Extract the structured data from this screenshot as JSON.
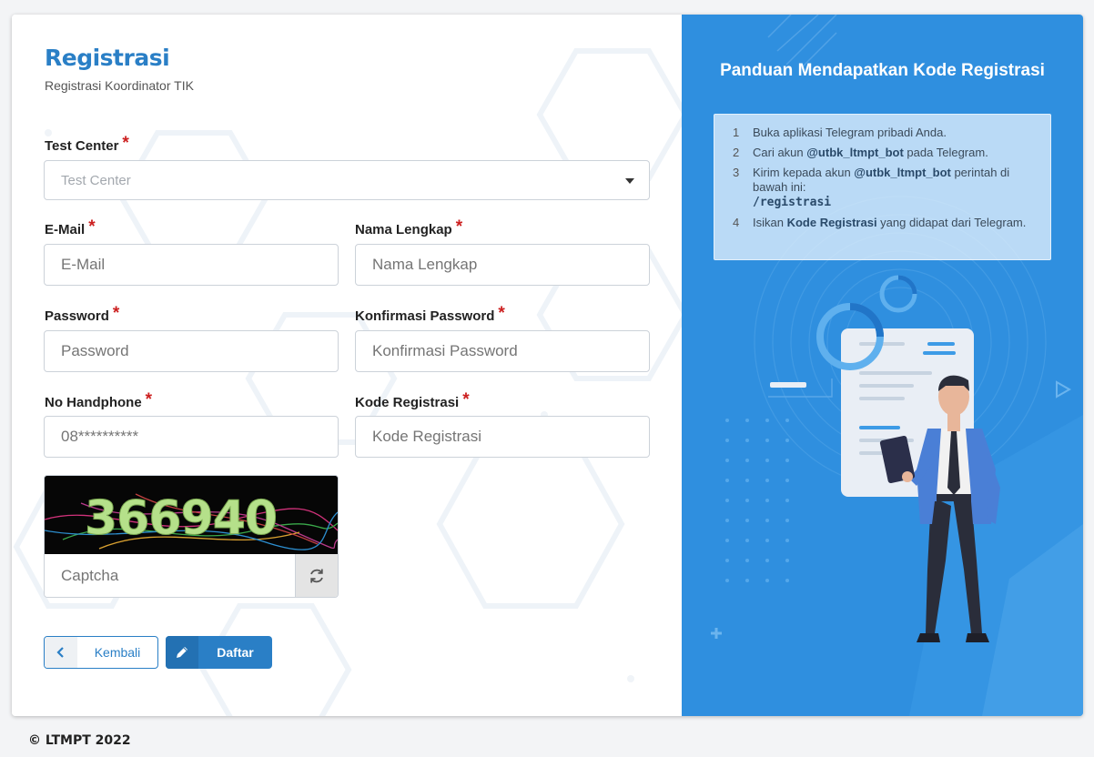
{
  "form": {
    "title": "Registrasi",
    "subtitle": "Registrasi Koordinator TIK",
    "required_mark": "*",
    "test_center": {
      "label": "Test Center",
      "placeholder": "Test Center"
    },
    "email": {
      "label": "E-Mail",
      "placeholder": "E-Mail"
    },
    "full_name": {
      "label": "Nama Lengkap",
      "placeholder": "Nama Lengkap"
    },
    "password": {
      "label": "Password",
      "placeholder": "Password"
    },
    "confirm_password": {
      "label": "Konfirmasi Password",
      "placeholder": "Konfirmasi Password"
    },
    "phone": {
      "label": "No Handphone",
      "placeholder": "08**********"
    },
    "registration_code": {
      "label": "Kode Registrasi",
      "placeholder": "Kode Registrasi"
    },
    "captcha": {
      "image_text": "366940",
      "placeholder": "Captcha"
    },
    "back_button": "Kembali",
    "submit_button": "Daftar"
  },
  "guide": {
    "title": "Panduan Mendapatkan Kode Registrasi",
    "steps": [
      {
        "num": "1",
        "text": "Buka aplikasi Telegram pribadi Anda."
      },
      {
        "num": "2",
        "pre": "Cari akun ",
        "bold": "@utbk_ltmpt_bot",
        "post": " pada Telegram."
      },
      {
        "num": "3",
        "pre": "Kirim kepada akun ",
        "bold": "@utbk_ltmpt_bot",
        "post": " perintah di bawah ini:",
        "command": "/registrasi"
      },
      {
        "num": "4",
        "pre": "Isikan ",
        "bold": "Kode Registrasi",
        "post": " yang didapat dari Telegram."
      }
    ]
  },
  "footer": {
    "copyright": "© LTMPT 2022"
  },
  "colors": {
    "accent": "#2a7fc6",
    "panel": "#2f8fdf",
    "required": "#cc1f1f"
  },
  "icons": {
    "back": "chevron-left-icon",
    "submit": "pencil-icon",
    "refresh": "refresh-icon",
    "select": "caret-down-icon"
  }
}
